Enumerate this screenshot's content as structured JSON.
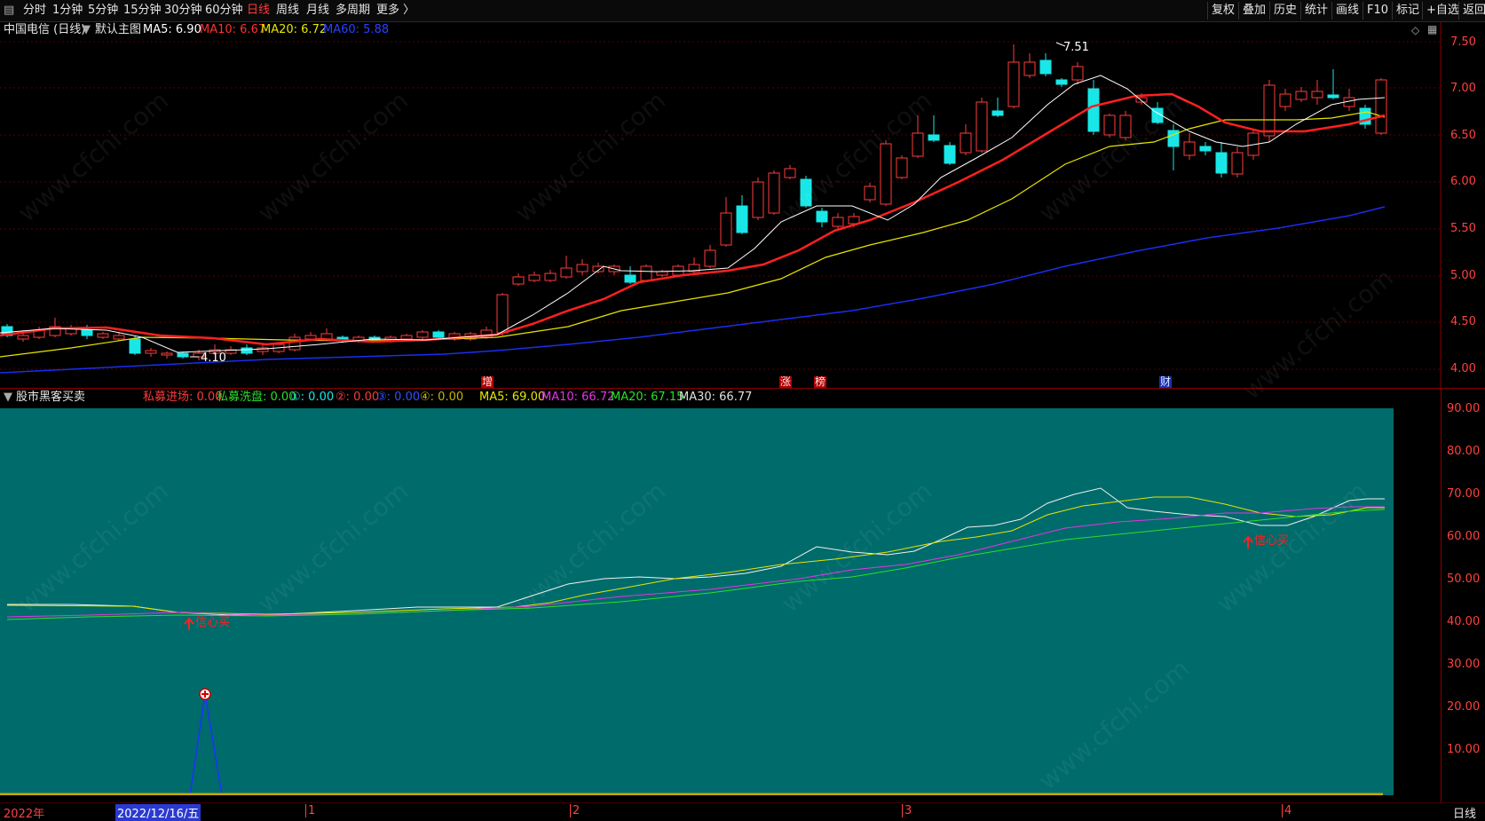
{
  "toolbar": {
    "menu_icon": "menu-icon",
    "tabs": [
      "分时",
      "1分钟",
      "5分钟",
      "15分钟",
      "30分钟",
      "60分钟",
      "日线",
      "周线",
      "月线",
      "多周期",
      "更多 〉"
    ],
    "active_tab": "日线",
    "right_buttons": [
      "复权",
      "叠加",
      "历史",
      "统计",
      "画线",
      "F10",
      "标记",
      "+自选",
      "返回"
    ]
  },
  "main_chart": {
    "stock_title": "中国电信 (日线)",
    "template": "默认主图",
    "ma5": "MA5: 6.90",
    "ma10": "MA10: 6.67",
    "ma20": "MA20: 6.72",
    "ma60": "MA60: 5.88",
    "high_label": "7.51",
    "low_label": "4.10",
    "markers": [
      "增",
      "涨",
      "榜",
      "财"
    ],
    "y_ticks": [
      "7.50",
      "7.00",
      "6.50",
      "6.00",
      "5.50",
      "5.00",
      "4.50",
      "4.00"
    ],
    "colors": {
      "up": "#ff3b3b",
      "down": "#19e6e6",
      "ma5": "#ffffff",
      "ma10": "#ff2020",
      "ma20": "#e6e600",
      "ma60": "#1a2ef0"
    }
  },
  "indicator": {
    "name": "股市黑客买卖",
    "fields": [
      {
        "text": "私募进场: 0.00",
        "color": "#ff3b3b"
      },
      {
        "text": "私募洗盘: 0.00",
        "color": "#2adf2a"
      },
      {
        "text": "①: 0.00",
        "color": "#19e6e6"
      },
      {
        "text": "②: 0.00",
        "color": "#ff3b3b"
      },
      {
        "text": "③: 0.00",
        "color": "#3050ff"
      },
      {
        "text": "④: 0.00",
        "color": "#c8b400"
      },
      {
        "text": "MA5: 69.00",
        "color": "#e6e600"
      },
      {
        "text": "MA10: 66.72",
        "color": "#e633e6"
      },
      {
        "text": "MA20: 67.15",
        "color": "#2adf2a"
      },
      {
        "text": "MA30: 66.77",
        "color": "#e0e0e0"
      }
    ],
    "buy_label_1": "信心买",
    "buy_label_2": "信心买",
    "y_ticks": [
      "90.00",
      "80.00",
      "70.00",
      "60.00",
      "50.00",
      "40.00",
      "30.00",
      "20.00",
      "10.00"
    ]
  },
  "datebar": {
    "year": "2022年",
    "cursor_date": "2022/12/16/五",
    "months": [
      "1",
      "2",
      "3",
      "4"
    ],
    "period": "日线"
  },
  "watermark": "www.cfchi.com"
}
